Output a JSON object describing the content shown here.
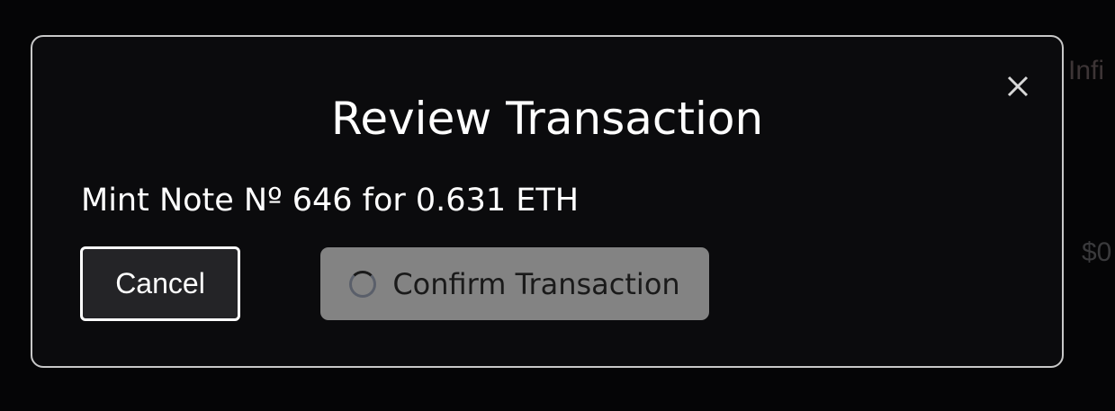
{
  "background": {
    "partial_text_top": "Infi",
    "partial_text_price": "$0"
  },
  "modal": {
    "title": "Review Transaction",
    "summary": "Mint Note Nº 646 for 0.631 ETH",
    "cancel_label": "Cancel",
    "confirm_label": "Confirm Transaction",
    "confirm_state": "loading",
    "close_icon": "close-icon"
  }
}
